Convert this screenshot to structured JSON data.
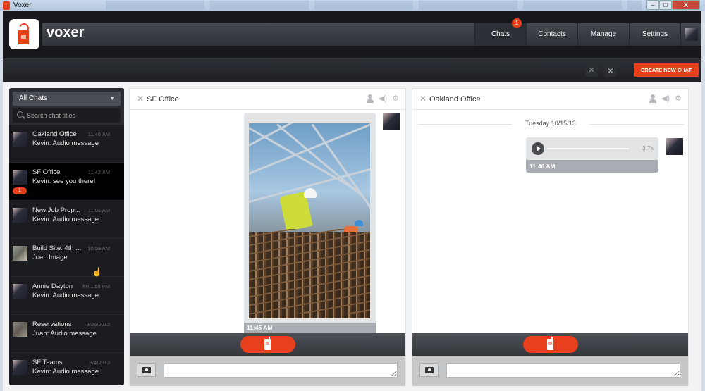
{
  "window": {
    "title": "Voxer",
    "controls": {
      "minimize": "–",
      "maximize": "□",
      "close": "X"
    }
  },
  "app": {
    "brand": "voxer",
    "nav": [
      {
        "label": "Chats",
        "badge": "1",
        "active": true
      },
      {
        "label": "Contacts"
      },
      {
        "label": "Manage"
      },
      {
        "label": "Settings"
      }
    ],
    "toolbar": {
      "mute_icon": "mute-icon",
      "close_icon": "×",
      "create_label": "CREATE NEW CHAT"
    },
    "colors": {
      "accent": "#e8401c",
      "dark": "#16181d"
    }
  },
  "sidebar": {
    "filter": "All Chats",
    "filter_arrow": "▼",
    "search_placeholder": "Search chat titles",
    "chats": [
      {
        "name": "Oakland Office",
        "time": "11:46 AM",
        "preview": "Kevin: Audio message"
      },
      {
        "name": "SF Office",
        "time": "11:42 AM",
        "preview": "Kevin: see you there!",
        "unread": "1",
        "selected": true
      },
      {
        "name": "New Job Prop...",
        "time": "11:01 AM",
        "preview": "Kevin: Audio message"
      },
      {
        "name": "Build Site: 4th ...",
        "time": "10:59 AM",
        "preview": "Joe : Image"
      },
      {
        "name": "Annie Dayton",
        "time": "Fri 1:50 PM",
        "preview": "Kevin: Audio message"
      },
      {
        "name": "Reservations",
        "time": "9/26/2013",
        "preview": "Juan: Audio message"
      },
      {
        "name": "SF Teams",
        "time": "9/4/2013",
        "preview": "Kevin: Audio message"
      }
    ]
  },
  "panels": {
    "sf": {
      "close": "✕",
      "title": "SF Office",
      "image_message": {
        "time": "11:45 AM"
      },
      "icons": {
        "volume": "🔊",
        "settings": "⚙"
      }
    },
    "oakland": {
      "close": "✕",
      "title": "Oakland Office",
      "date_separator": "Tuesday 10/15/13",
      "audio_message": {
        "duration": "3.7s",
        "time": "11:46 AM"
      },
      "icons": {
        "volume": "🔊",
        "settings": "⚙"
      }
    }
  }
}
